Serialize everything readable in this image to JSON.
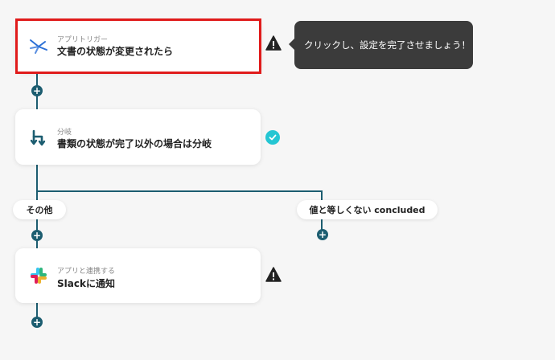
{
  "trigger": {
    "subtitle": "アプリトリガー",
    "title": "文書の状態が変更されたら",
    "tooltip": "クリックし、設定を完了させましょう！",
    "icon": "app-trigger-icon"
  },
  "branch": {
    "subtitle": "分岐",
    "title": "書類の状態が完了以外の場合は分岐",
    "icon": "branch-icon"
  },
  "branches": {
    "other_label": "その他",
    "condition_label": "値と等しくない concluded"
  },
  "action": {
    "subtitle": "アプリと連携する",
    "title": "Slackに通知",
    "icon": "slack-icon"
  },
  "colors": {
    "line": "#1c5d70",
    "highlight": "#e01b1b",
    "check": "#24c6d3",
    "tooltip_bg": "#3b3b3b"
  }
}
